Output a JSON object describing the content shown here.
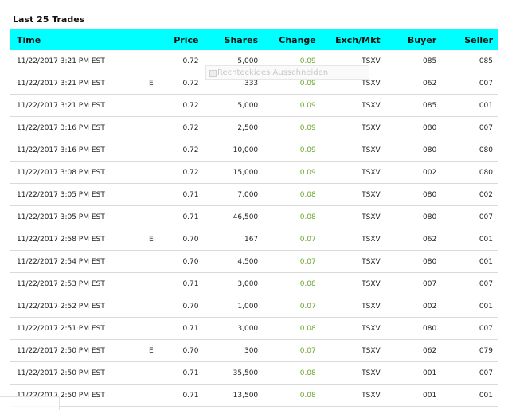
{
  "title": "Last 25 Trades",
  "columns": {
    "time": "Time",
    "price": "Price",
    "shares": "Shares",
    "change": "Change",
    "exch": "Exch/Mkt",
    "buyer": "Buyer",
    "seller": "Seller"
  },
  "rows": [
    {
      "time": "11/22/2017 3:21 PM EST",
      "flag": "",
      "price": "0.72",
      "shares": "5,000",
      "change": "0.09",
      "exch": "TSXV",
      "buyer": "085",
      "seller": "085"
    },
    {
      "time": "11/22/2017 3:21 PM EST",
      "flag": "E",
      "price": "0.72",
      "shares": "333",
      "change": "0.09",
      "exch": "TSXV",
      "buyer": "062",
      "seller": "007"
    },
    {
      "time": "11/22/2017 3:21 PM EST",
      "flag": "",
      "price": "0.72",
      "shares": "5,000",
      "change": "0.09",
      "exch": "TSXV",
      "buyer": "085",
      "seller": "001"
    },
    {
      "time": "11/22/2017 3:16 PM EST",
      "flag": "",
      "price": "0.72",
      "shares": "2,500",
      "change": "0.09",
      "exch": "TSXV",
      "buyer": "080",
      "seller": "007"
    },
    {
      "time": "11/22/2017 3:16 PM EST",
      "flag": "",
      "price": "0.72",
      "shares": "10,000",
      "change": "0.09",
      "exch": "TSXV",
      "buyer": "080",
      "seller": "080"
    },
    {
      "time": "11/22/2017 3:08 PM EST",
      "flag": "",
      "price": "0.72",
      "shares": "15,000",
      "change": "0.09",
      "exch": "TSXV",
      "buyer": "002",
      "seller": "080"
    },
    {
      "time": "11/22/2017 3:05 PM EST",
      "flag": "",
      "price": "0.71",
      "shares": "7,000",
      "change": "0.08",
      "exch": "TSXV",
      "buyer": "080",
      "seller": "002"
    },
    {
      "time": "11/22/2017 3:05 PM EST",
      "flag": "",
      "price": "0.71",
      "shares": "46,500",
      "change": "0.08",
      "exch": "TSXV",
      "buyer": "080",
      "seller": "007"
    },
    {
      "time": "11/22/2017 2:58 PM EST",
      "flag": "E",
      "price": "0.70",
      "shares": "167",
      "change": "0.07",
      "exch": "TSXV",
      "buyer": "062",
      "seller": "001"
    },
    {
      "time": "11/22/2017 2:54 PM EST",
      "flag": "",
      "price": "0.70",
      "shares": "4,500",
      "change": "0.07",
      "exch": "TSXV",
      "buyer": "080",
      "seller": "001"
    },
    {
      "time": "11/22/2017 2:53 PM EST",
      "flag": "",
      "price": "0.71",
      "shares": "3,000",
      "change": "0.08",
      "exch": "TSXV",
      "buyer": "007",
      "seller": "007"
    },
    {
      "time": "11/22/2017 2:52 PM EST",
      "flag": "",
      "price": "0.70",
      "shares": "1,000",
      "change": "0.07",
      "exch": "TSXV",
      "buyer": "002",
      "seller": "001"
    },
    {
      "time": "11/22/2017 2:51 PM EST",
      "flag": "",
      "price": "0.71",
      "shares": "3,000",
      "change": "0.08",
      "exch": "TSXV",
      "buyer": "080",
      "seller": "007"
    },
    {
      "time": "11/22/2017 2:50 PM EST",
      "flag": "E",
      "price": "0.70",
      "shares": "300",
      "change": "0.07",
      "exch": "TSXV",
      "buyer": "062",
      "seller": "079"
    },
    {
      "time": "11/22/2017 2:50 PM EST",
      "flag": "",
      "price": "0.71",
      "shares": "35,500",
      "change": "0.08",
      "exch": "TSXV",
      "buyer": "001",
      "seller": "007"
    },
    {
      "time": "11/22/2017 2:50 PM EST",
      "flag": "",
      "price": "0.71",
      "shares": "13,500",
      "change": "0.08",
      "exch": "TSXV",
      "buyer": "001",
      "seller": "001"
    }
  ],
  "overlay": {
    "ghost_text": "Rechteckiges Ausschneiden"
  },
  "colors": {
    "header_bg": "#00ffff",
    "change_text": "#6aa52a",
    "row_divider": "#d9d9d9"
  }
}
